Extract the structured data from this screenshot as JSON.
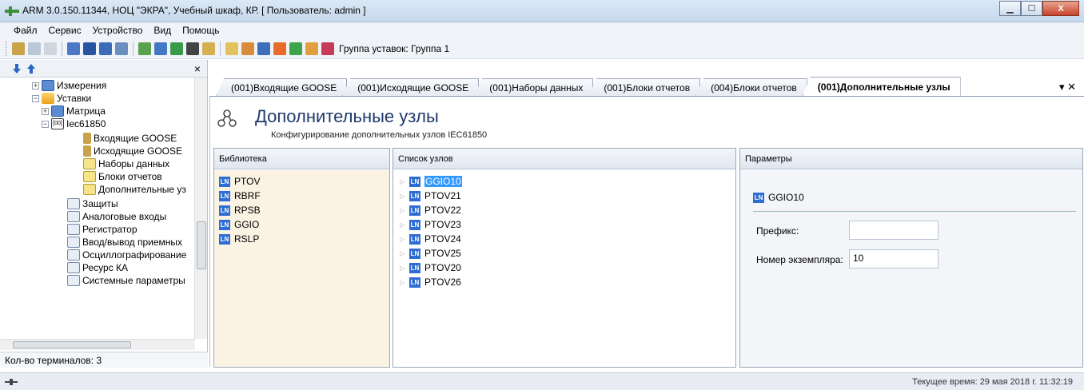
{
  "window": {
    "title": "ARM 3.0.150.11344, НОЦ \"ЭКРА\", Учебный шкаф, КР. [ Пользователь: admin ]",
    "minimize_label": "▁",
    "maximize_label": "☐",
    "close_label": "X"
  },
  "menu": [
    "Файл",
    "Сервис",
    "Устройство",
    "Вид",
    "Помощь"
  ],
  "toolbar": {
    "group_label": "Группа уставок: Группа 1"
  },
  "left_panel": {
    "close_label": "×",
    "tree": [
      {
        "label": "Измерения",
        "icon": "measurements-icon"
      },
      {
        "label": "Уставки",
        "icon": "folder-icon"
      },
      {
        "label": "Матрица",
        "icon": "matrix-icon"
      },
      {
        "label": "Iec61850",
        "icon": "iec-icon"
      },
      {
        "label": "Входящие GOOSE",
        "icon": "goose-icon"
      },
      {
        "label": "Исходящие GOOSE",
        "icon": "goose-icon"
      },
      {
        "label": "Наборы данных",
        "icon": "dataset-icon"
      },
      {
        "label": "Блоки отчетов",
        "icon": "dataset-icon"
      },
      {
        "label": "Дополнительные уз",
        "icon": "dataset-icon"
      },
      {
        "label": "Защиты",
        "icon": "table-icon"
      },
      {
        "label": "Аналоговые входы",
        "icon": "table-icon"
      },
      {
        "label": "Регистратор",
        "icon": "table-icon"
      },
      {
        "label": "Ввод/вывод приемных",
        "icon": "table-icon"
      },
      {
        "label": "Осциллографирование",
        "icon": "table-icon"
      },
      {
        "label": "Ресурс КА",
        "icon": "table-icon"
      },
      {
        "label": "Системные параметры",
        "icon": "table-icon"
      }
    ],
    "footer": "Кол-во терминалов: 3"
  },
  "tabs": [
    "(001)Входящие GOOSE",
    "(001)Исходящие GOOSE",
    "(001)Наборы данных",
    "(001)Блоки отчетов",
    "(004)Блоки отчетов",
    "(001)Дополнительные узлы"
  ],
  "tab_controls": "▾ ✕",
  "page": {
    "title": "Дополнительные узлы",
    "subtitle": "Конфигурирование дополнительных узлов IEC61850"
  },
  "library": {
    "header": "Библиотека",
    "items": [
      "PTOV",
      "RBRF",
      "RPSB",
      "GGIO",
      "RSLP"
    ]
  },
  "nodes": {
    "header": "Список узлов",
    "items": [
      "GGIO10",
      "PTOV21",
      "PTOV22",
      "PTOV23",
      "PTOV24",
      "PTOV25",
      "PTOV20",
      "PTOV26"
    ]
  },
  "ln_badge": "LN",
  "params": {
    "header": "Параметры",
    "node": "GGIO10",
    "prefix_label": "Префикс:",
    "prefix_value": "",
    "instance_label": "Номер экземпляра:",
    "instance_value": "10"
  },
  "status": {
    "time": "Текущее время: 29 мая 2018 г. 11:32:19"
  }
}
